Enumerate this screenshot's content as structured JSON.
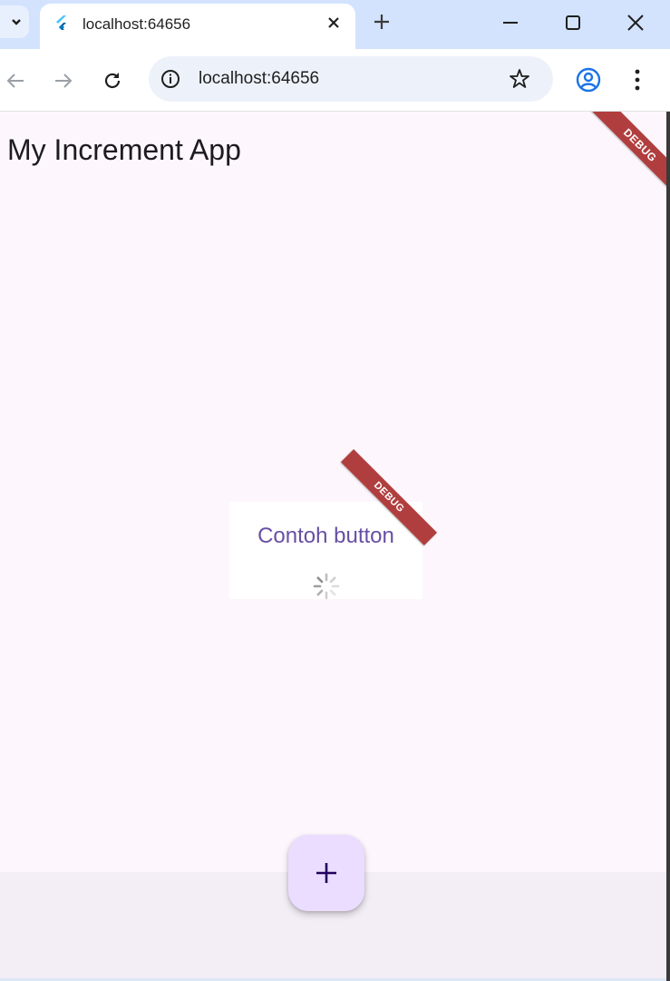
{
  "browser": {
    "tab_title": "localhost:64656",
    "url": "localhost:64656",
    "icons": [
      "tab-search-icon",
      "flutter-favicon-icon",
      "close-icon",
      "plus-icon",
      "minimize-icon",
      "maximize-icon",
      "window-close-icon",
      "back-arrow-icon",
      "forward-arrow-icon",
      "reload-icon",
      "site-info-icon",
      "bookmark-star-icon",
      "profile-icon",
      "more-menu-icon"
    ]
  },
  "app": {
    "title": "My Increment App",
    "button_label": "Contoh button",
    "debug_label": "DEBUG",
    "fab_icon": "add-icon",
    "colors": {
      "accent": "#6750a4",
      "background": "#fdf7fd",
      "fab": "#eaddff",
      "debug": "#b13e3e"
    }
  }
}
